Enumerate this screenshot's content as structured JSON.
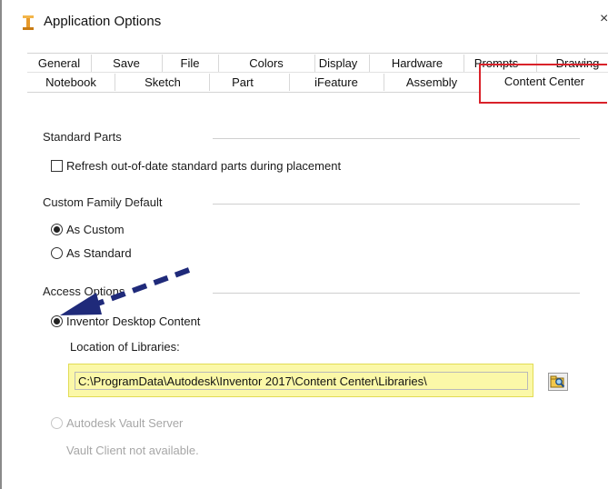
{
  "window": {
    "title": "Application Options",
    "close_glyph": "×"
  },
  "tabs": {
    "row1": [
      "General",
      "Save",
      "File",
      "Colors",
      "Display",
      "Hardware",
      "Prompts",
      "Drawing"
    ],
    "row2": [
      "Notebook",
      "Sketch",
      "Part",
      "iFeature",
      "Assembly",
      "Content Center"
    ],
    "active": "Content Center"
  },
  "standard_parts": {
    "heading": "Standard Parts",
    "refresh_label": "Refresh out-of-date standard parts during placement",
    "refresh_checked": false
  },
  "custom_family_default": {
    "heading": "Custom Family Default",
    "options": [
      "As Custom",
      "As Standard"
    ],
    "selected": "As Custom"
  },
  "access_options": {
    "heading": "Access Options",
    "desktop_content_label": "Inventor Desktop Content",
    "desktop_selected": true,
    "location_label": "Location of Libraries:",
    "location_value": "C:\\ProgramData\\Autodesk\\Inventor 2017\\Content Center\\Libraries\\",
    "vault_server_label": "Autodesk Vault Server",
    "vault_status": "Vault Client not available."
  },
  "icons": {
    "app": "inventor-app-icon",
    "browse": "folder-search-icon",
    "annotation": "dashed-arrow-annotation"
  },
  "colors": {
    "highlight_red": "#d9222a",
    "highlight_yellow": "#fbf8a8",
    "arrow_blue": "#1f2a7a"
  }
}
